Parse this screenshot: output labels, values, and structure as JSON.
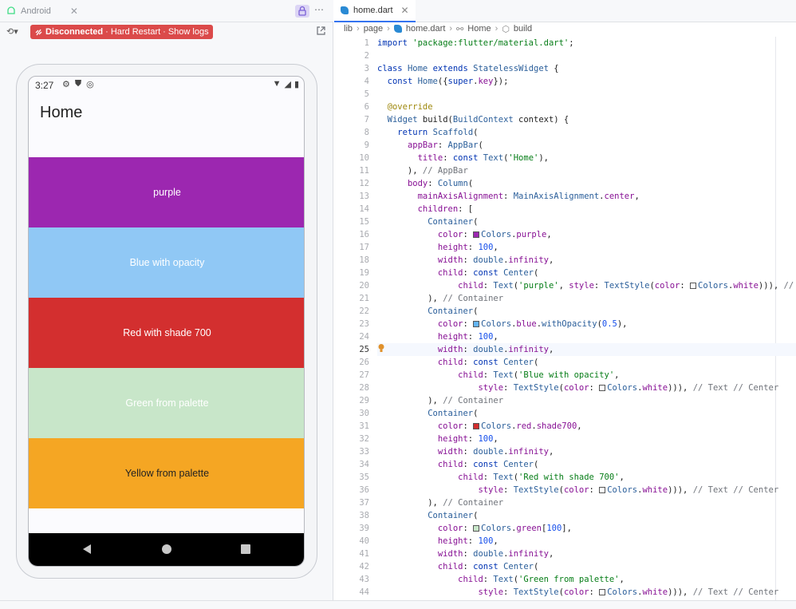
{
  "left_panel": {
    "tab_label": "Android",
    "status": {
      "state": "Disconnected",
      "action1": "Hard Restart",
      "action2": "Show logs"
    },
    "phone": {
      "time": "3:27",
      "app_title": "Home",
      "boxes": [
        {
          "label": "purple",
          "color": "#9c27b0",
          "text_color": "#ffffff"
        },
        {
          "label": "Blue with opacity",
          "color": "#90c8f5",
          "text_color": "#ffffff"
        },
        {
          "label": "Red with shade 700",
          "color": "#d32f2f",
          "text_color": "#ffffff"
        },
        {
          "label": "Green from palette",
          "color": "#c8e6c9",
          "text_color": "#ffffff"
        },
        {
          "label": "Yellow from palette",
          "color": "#f5a623",
          "text_color": "#222222"
        }
      ]
    }
  },
  "editor": {
    "tab_label": "home.dart",
    "breadcrumb": [
      "lib",
      "page",
      "home.dart",
      "Home",
      "build"
    ],
    "current_line": 25,
    "line_numbers": [
      "1",
      "2",
      "3",
      "4",
      "5",
      "6",
      "7",
      "8",
      "9",
      "10",
      "11",
      "12",
      "13",
      "14",
      "15",
      "16",
      "17",
      "18",
      "19",
      "20",
      "21",
      "22",
      "23",
      "24",
      "25",
      "26",
      "27",
      "28",
      "29",
      "30",
      "31",
      "32",
      "33",
      "34",
      "35",
      "36",
      "37",
      "38",
      "39",
      "40",
      "41",
      "42",
      "43",
      "44"
    ]
  }
}
